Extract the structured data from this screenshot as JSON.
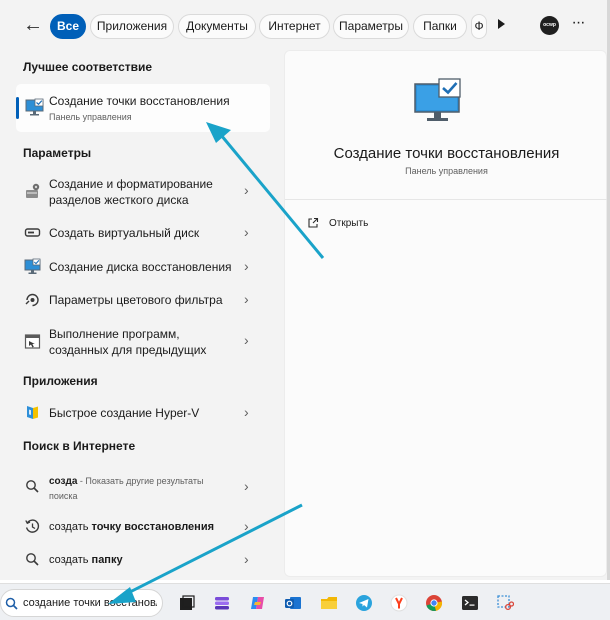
{
  "topbar": {
    "back_label": "←",
    "filters": [
      {
        "label": "Все",
        "active": true
      },
      {
        "label": "Приложения",
        "active": false
      },
      {
        "label": "Документы",
        "active": false
      },
      {
        "label": "Интернет",
        "active": false
      },
      {
        "label": "Параметры",
        "active": false
      },
      {
        "label": "Папки",
        "active": false
      },
      {
        "label": "Ф",
        "active": false
      }
    ],
    "avatar_text": "ocwp",
    "more_label": "···"
  },
  "results": {
    "best_match_heading": "Лучшее соответствие",
    "best_match": {
      "title": "Создание точки восстановления",
      "subtitle": "Панель управления"
    },
    "settings_heading": "Параметры",
    "settings_items": [
      {
        "line1": "Создание и форматирование",
        "line2": "разделов жесткого диска"
      },
      {
        "line1": "Создать виртуальный диск"
      },
      {
        "line1": "Создание диска восстановления"
      },
      {
        "line1": "Параметры цветового фильтра"
      },
      {
        "line1": "Выполнение программ,",
        "line2": "созданных для предыдущих"
      }
    ],
    "apps_heading": "Приложения",
    "apps_items": [
      {
        "line1": "Быстрое создание Hyper-V"
      }
    ],
    "web_heading": "Поиск в Интернете",
    "web_items": [
      {
        "bold": "созда",
        "rest": " - Показать другие результаты",
        "line2": "поиска"
      },
      {
        "plain": "создать ",
        "bold": "точку восстановления"
      },
      {
        "plain": "создать ",
        "bold": "папку"
      }
    ],
    "chevron": "›"
  },
  "preview": {
    "title": "Создание точки восстановления",
    "subtitle": "Панель управления",
    "open_label": "Открыть"
  },
  "taskbar": {
    "search_value": "создание точки восстановле"
  },
  "colors": {
    "accent": "#005fb8",
    "annotation_arrow": "#1aa3c9"
  }
}
